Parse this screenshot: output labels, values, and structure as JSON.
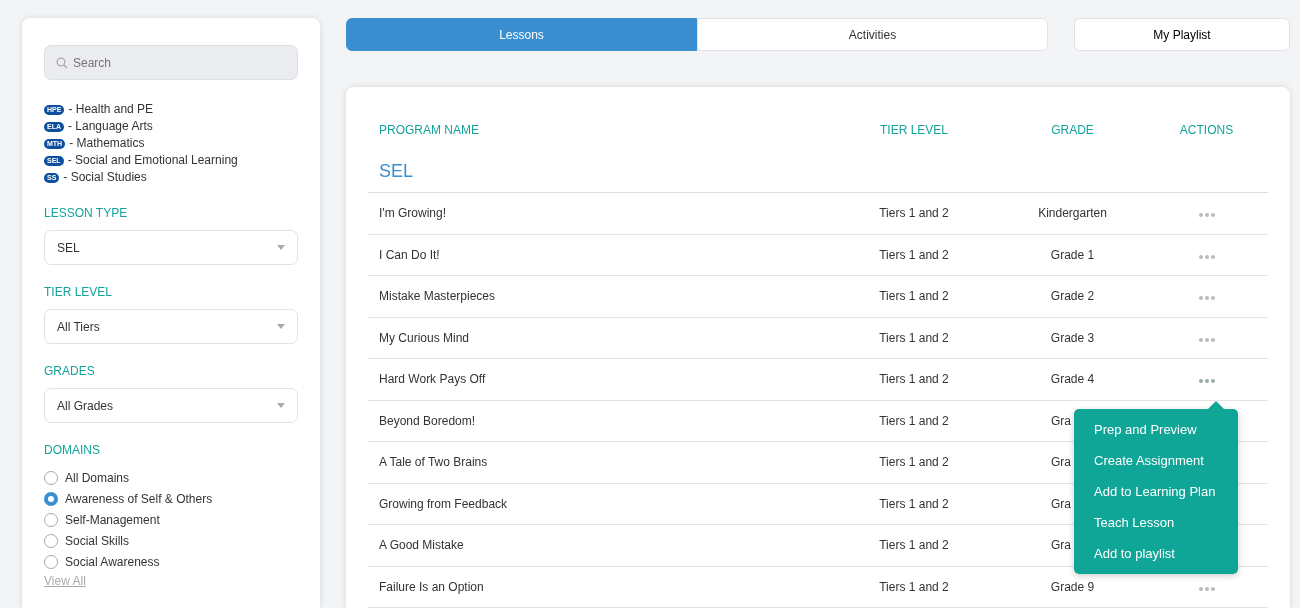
{
  "sidebar": {
    "search": {
      "placeholder": "Search"
    },
    "legend": [
      {
        "code": "HPE",
        "label": "- Health and PE"
      },
      {
        "code": "ELA",
        "label": "- Language Arts"
      },
      {
        "code": "MTH",
        "label": "- Mathematics"
      },
      {
        "code": "SEL",
        "label": "- Social and Emotional Learning"
      },
      {
        "code": "SS",
        "label": "- Social Studies"
      }
    ],
    "filters": [
      {
        "label": "LESSON TYPE",
        "value": "SEL"
      },
      {
        "label": "TIER LEVEL",
        "value": "All Tiers"
      },
      {
        "label": "GRADES",
        "value": "All Grades"
      }
    ],
    "domains": {
      "label": "DOMAINS",
      "options": [
        {
          "label": "All Domains",
          "selected": false
        },
        {
          "label": "Awareness of Self & Others",
          "selected": true
        },
        {
          "label": "Self-Management",
          "selected": false
        },
        {
          "label": "Social Skills",
          "selected": false
        },
        {
          "label": "Social Awareness",
          "selected": false
        }
      ],
      "view_all": "View All"
    }
  },
  "tabs": [
    {
      "label": "Lessons",
      "selected": true
    },
    {
      "label": "Activities",
      "selected": false
    }
  ],
  "playlist_button": "My Playlist",
  "table": {
    "columns": [
      "PROGRAM NAME",
      "TIER LEVEL",
      "GRADE",
      "ACTIONS"
    ],
    "group": "SEL",
    "rows": [
      {
        "name": "I'm Growing!",
        "tier": "Tiers 1 and 2",
        "grade": "Kindergarten",
        "menu_open": false
      },
      {
        "name": "I Can Do It!",
        "tier": "Tiers 1 and 2",
        "grade": "Grade 1",
        "menu_open": false
      },
      {
        "name": "Mistake Masterpieces",
        "tier": "Tiers 1 and 2",
        "grade": "Grade 2",
        "menu_open": false
      },
      {
        "name": "My Curious Mind",
        "tier": "Tiers 1 and 2",
        "grade": "Grade 3",
        "menu_open": false
      },
      {
        "name": "Hard Work Pays Off",
        "tier": "Tiers 1 and 2",
        "grade": "Grade 4",
        "menu_open": true
      },
      {
        "name": "Beyond Boredom!",
        "tier": "Tiers 1 and 2",
        "grade": "Gra"
      },
      {
        "name": "A Tale of Two Brains",
        "tier": "Tiers 1 and 2",
        "grade": "Gra"
      },
      {
        "name": "Growing from Feedback",
        "tier": "Tiers 1 and 2",
        "grade": "Gra"
      },
      {
        "name": "A Good Mistake",
        "tier": "Tiers 1 and 2",
        "grade": "Gra"
      },
      {
        "name": "Failure Is an Option",
        "tier": "Tiers 1 and 2",
        "grade": "Grade 9",
        "menu_open": false
      }
    ]
  },
  "actions_menu": {
    "items": [
      "Prep and Preview",
      "Create Assignment",
      "Add to Learning Plan",
      "Teach Lesson",
      "Add to playlist"
    ]
  }
}
